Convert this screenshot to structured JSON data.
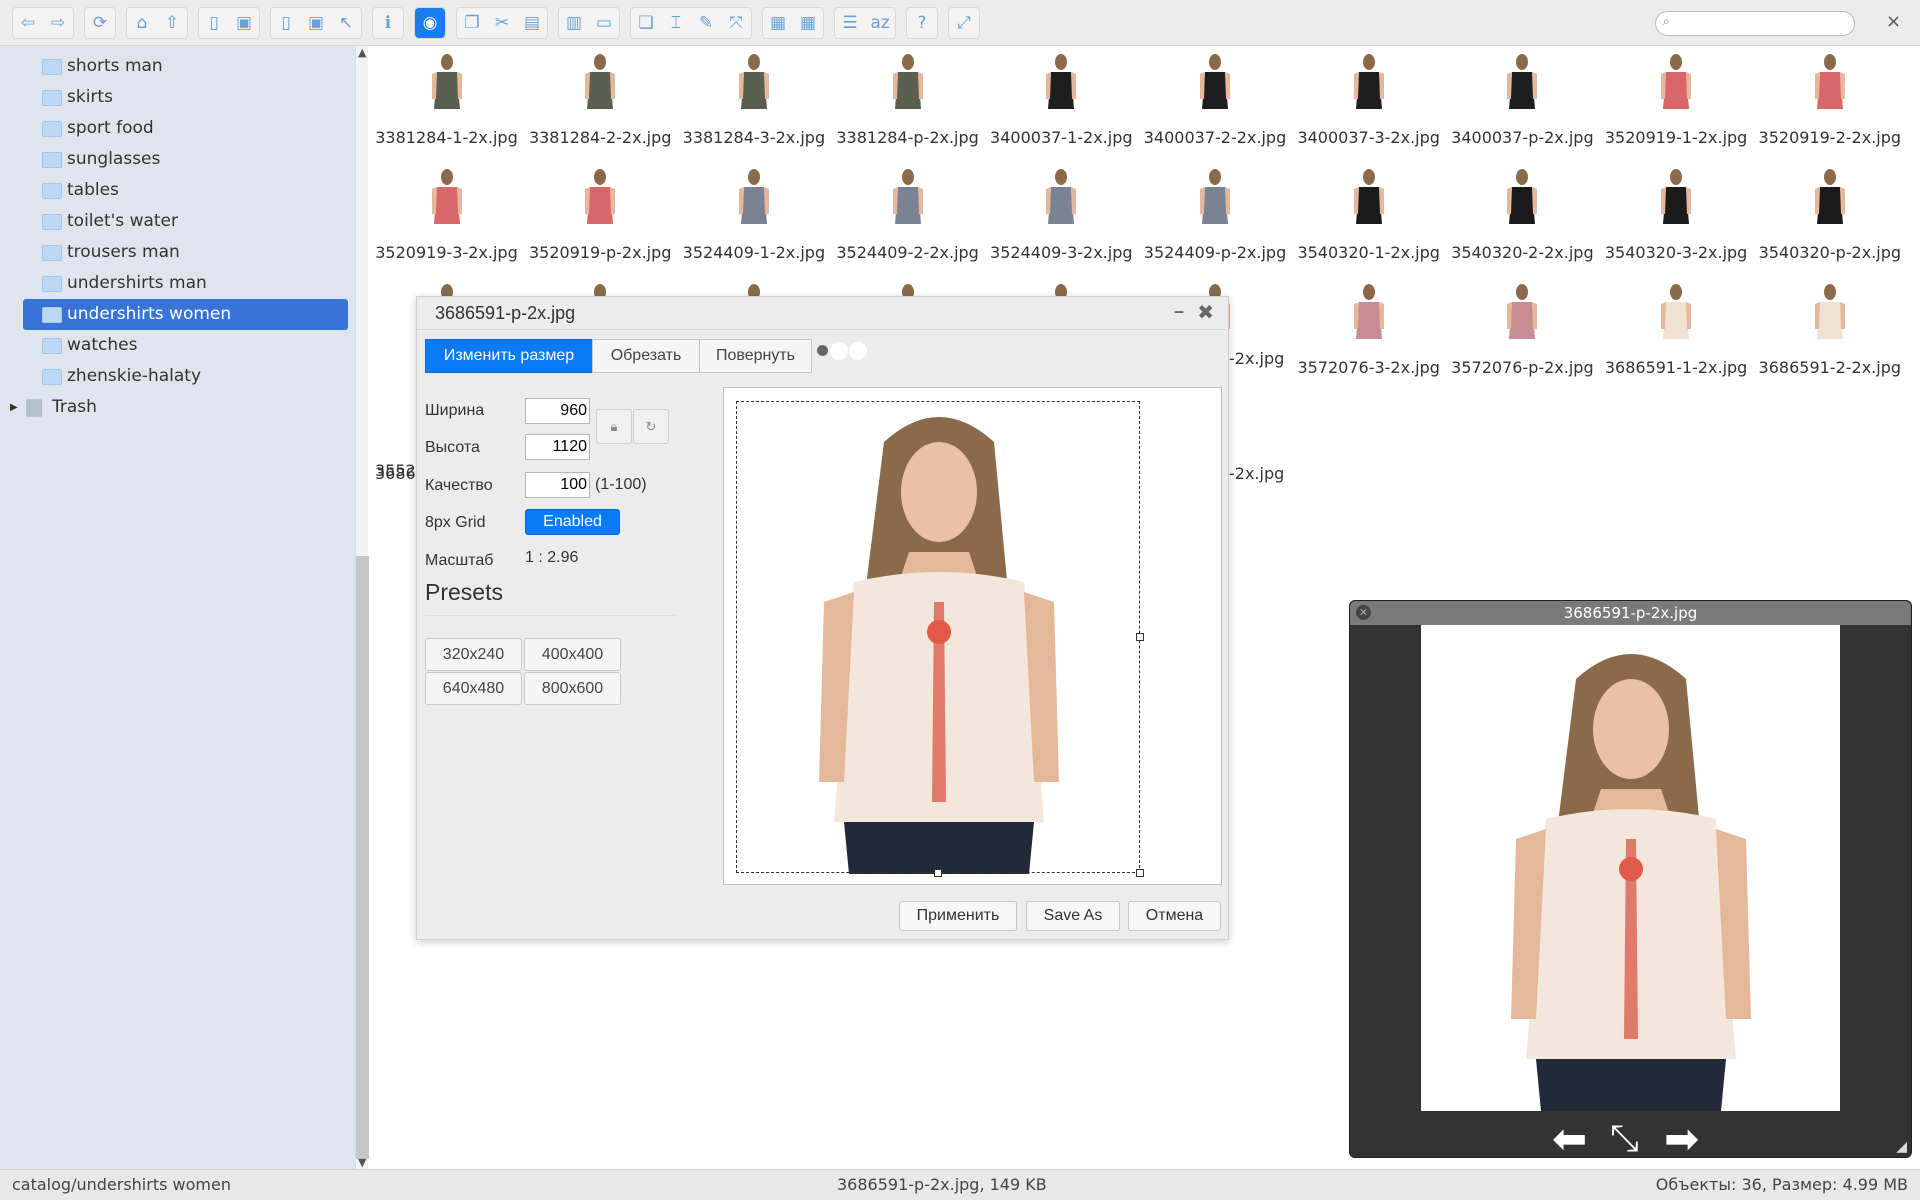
{
  "toolbar": {
    "groups": [
      [
        "back-icon",
        "forward-icon"
      ],
      [
        "reload-icon"
      ],
      [
        "home-icon",
        "up-icon"
      ],
      [
        "new-folder-icon",
        "save-as-icon"
      ],
      [
        "open-icon",
        "save-icon",
        "select-icon"
      ],
      [
        "info-icon"
      ],
      [
        "preview-eye-icon"
      ],
      [
        "copy-icon",
        "cut-icon",
        "paste-icon"
      ],
      [
        "archive-icon",
        "delete-icon"
      ],
      [
        "duplicate-icon",
        "rename-icon",
        "edit-icon",
        "resize-icon"
      ],
      [
        "extract-icon",
        "create-archive-icon"
      ],
      [
        "view-icon",
        "sort-icon"
      ],
      [
        "help-icon"
      ],
      [
        "fullscreen-icon"
      ]
    ],
    "search_placeholder": "",
    "accent": "#1a7cf0"
  },
  "sidebar": {
    "items": [
      {
        "label": "shorts man"
      },
      {
        "label": "skirts"
      },
      {
        "label": "sport food"
      },
      {
        "label": "sunglasses"
      },
      {
        "label": "tables"
      },
      {
        "label": "toilet's water"
      },
      {
        "label": "trousers man"
      },
      {
        "label": "undershirts man"
      },
      {
        "label": "undershirts women",
        "selected": true
      },
      {
        "label": "watches"
      },
      {
        "label": "zhenskie-halaty"
      }
    ],
    "trash": "Trash",
    "selected_color": "#3874d7"
  },
  "files": [
    {
      "name": "3381284-1-2x.jpg",
      "color": "#5b5f50"
    },
    {
      "name": "3381284-2-2x.jpg",
      "color": "#5b5f50"
    },
    {
      "name": "3381284-3-2x.jpg",
      "color": "#5b5f50"
    },
    {
      "name": "3381284-p-2x.jpg",
      "color": "#5b5f50"
    },
    {
      "name": "3400037-1-2x.jpg",
      "color": "#1e1e1e"
    },
    {
      "name": "3400037-2-2x.jpg",
      "color": "#1e1e1e"
    },
    {
      "name": "3400037-3-2x.jpg",
      "color": "#1e1e1e"
    },
    {
      "name": "3400037-p-2x.jpg",
      "color": "#1e1e1e"
    },
    {
      "name": "3520919-1-2x.jpg",
      "color": "#d9666b"
    },
    {
      "name": "3520919-2-2x.jpg",
      "color": "#d9666b"
    },
    {
      "name": "3520919-3-2x.jpg",
      "color": "#d9666b"
    },
    {
      "name": "3520919-p-2x.jpg",
      "color": "#d9666b"
    },
    {
      "name": "3524409-1-2x.jpg",
      "color": "#7b8294"
    },
    {
      "name": "3524409-2-2x.jpg",
      "color": "#7b8294"
    },
    {
      "name": "3524409-3-2x.jpg",
      "color": "#7b8294"
    },
    {
      "name": "3524409-p-2x.jpg",
      "color": "#7b8294"
    },
    {
      "name": "3540320-1-2x.jpg",
      "color": "#1a1a1a"
    },
    {
      "name": "3540320-2-2x.jpg",
      "color": "#1a1a1a"
    },
    {
      "name": "3540320-3-2x.jpg",
      "color": "#1a1a1a"
    },
    {
      "name": "3540320-p-2x.jpg",
      "color": "#1a1a1a"
    },
    {
      "name": "",
      "color": "#555"
    },
    {
      "name": "",
      "color": "#333"
    },
    {
      "name": "",
      "color": "#555"
    },
    {
      "name": "",
      "color": "#555"
    },
    {
      "name": "",
      "color": "#555"
    },
    {
      "name": "",
      "color": "#555"
    },
    {
      "name": "3572076-3-2x.jpg",
      "color": "#c98c92"
    },
    {
      "name": "3572076-p-2x.jpg",
      "color": "#c98c92"
    },
    {
      "name": "3686591-1-2x.jpg",
      "color": "#efe2d2"
    },
    {
      "name": "3686591-2-2x.jpg",
      "color": "#efe2d2"
    }
  ],
  "fragments": {
    "row3_col1": "3552",
    "row3_col6": "-2x.jpg",
    "row4_col1": "3686",
    "row4_col6": "-2x.jpg"
  },
  "dialog": {
    "title": "3686591-p-2x.jpg",
    "tabs": [
      "Изменить размер",
      "Обрезать",
      "Повернуть"
    ],
    "width_label": "Ширина",
    "width_value": "960",
    "height_label": "Высота",
    "height_value": "1120",
    "quality_label": "Качество",
    "quality_value": "100",
    "quality_hint": "(1-100)",
    "grid_label": "8px Grid",
    "grid_value": "Enabled",
    "scale_label": "Масштаб",
    "scale_value": "1 : 2.96",
    "presets_title": "Presets",
    "presets": [
      "320x240",
      "400x400",
      "640x480",
      "800x600"
    ],
    "apply": "Применить",
    "save_as": "Save As",
    "cancel": "Отмена"
  },
  "viewer": {
    "title": "3686591-p-2x.jpg"
  },
  "status": {
    "path": "catalog/undershirts women",
    "selection": "3686591-p-2x.jpg, 149 KB",
    "summary": "Объекты: 36, Размер: 4.99 MB"
  }
}
